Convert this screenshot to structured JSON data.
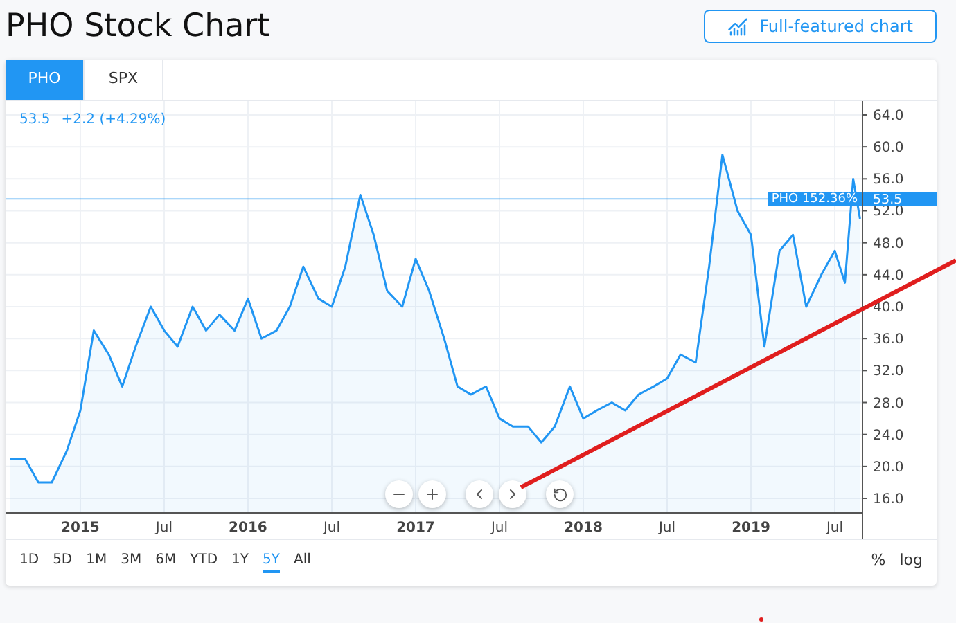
{
  "page_title": "PHO Stock Chart",
  "full_chart_button": "Full-featured chart",
  "tabs": [
    {
      "label": "PHO",
      "selected": true
    },
    {
      "label": "SPX",
      "selected": false
    }
  ],
  "legend": {
    "price": "53.5",
    "change": "+2.2 (+4.29%)"
  },
  "chart": {
    "chart_data": {
      "type": "area",
      "x": [
        2014.58,
        2014.67,
        2014.75,
        2014.83,
        2014.92,
        2015.0,
        2015.08,
        2015.17,
        2015.25,
        2015.33,
        2015.42,
        2015.5,
        2015.58,
        2015.67,
        2015.75,
        2015.83,
        2015.92,
        2016.0,
        2016.08,
        2016.17,
        2016.25,
        2016.33,
        2016.42,
        2016.5,
        2016.58,
        2016.67,
        2016.75,
        2016.83,
        2016.92,
        2017.0,
        2017.08,
        2017.17,
        2017.25,
        2017.33,
        2017.42,
        2017.5,
        2017.58,
        2017.67,
        2017.75,
        2017.83,
        2017.92,
        2018.0,
        2018.08,
        2018.17,
        2018.25,
        2018.33,
        2018.42,
        2018.5,
        2018.58,
        2018.67,
        2018.75,
        2018.83,
        2018.92,
        2019.0,
        2019.08,
        2019.17,
        2019.25,
        2019.33,
        2019.42,
        2019.5,
        2019.56,
        2019.61,
        2019.65
      ],
      "series": [
        {
          "name": "PHO",
          "color": "#2196f3",
          "values": [
            21,
            21,
            18,
            18,
            22,
            27,
            37,
            34,
            30,
            35,
            40,
            37,
            35,
            40,
            37,
            39,
            37,
            41,
            36,
            37,
            40,
            45,
            41,
            40,
            45,
            54,
            49,
            42,
            40,
            46,
            42,
            36,
            30,
            29,
            30,
            26,
            25,
            25,
            23,
            25,
            30,
            26,
            27,
            28,
            27,
            29,
            30,
            31,
            34,
            33,
            45,
            59,
            52,
            49,
            35,
            47,
            49,
            40,
            44,
            47,
            43,
            56,
            51
          ]
        }
      ],
      "xlim": [
        2014.554,
        2019.661
      ],
      "ylim": [
        14.27,
        65.73
      ],
      "xticks": [
        {
          "value": 2015,
          "label": "2015"
        },
        {
          "value": 2015.5,
          "label": "Jul"
        },
        {
          "value": 2016,
          "label": "2016"
        },
        {
          "value": 2016.5,
          "label": "Jul"
        },
        {
          "value": 2017,
          "label": "2017"
        },
        {
          "value": 2017.5,
          "label": "Jul"
        },
        {
          "value": 2018,
          "label": "2018"
        },
        {
          "value": 2018.5,
          "label": "Jul"
        },
        {
          "value": 2019,
          "label": "2019"
        },
        {
          "value": 2019.5,
          "label": "Jul"
        }
      ],
      "yticks": [
        {
          "value": 16,
          "label": "16.0"
        },
        {
          "value": 20,
          "label": "20.0"
        },
        {
          "value": 24,
          "label": "24.0"
        },
        {
          "value": 28,
          "label": "28.0"
        },
        {
          "value": 32,
          "label": "32.0"
        },
        {
          "value": 36,
          "label": "36.0"
        },
        {
          "value": 40,
          "label": "40.0"
        },
        {
          "value": 44,
          "label": "44.0"
        },
        {
          "value": 48,
          "label": "48.0"
        },
        {
          "value": 52,
          "label": "52.0"
        },
        {
          "value": 56,
          "label": "56.0"
        },
        {
          "value": 60,
          "label": "60.0"
        },
        {
          "value": 64,
          "label": "64.0"
        }
      ],
      "grid": true,
      "ref_lines": [
        {
          "axis": "y",
          "value": 53.5
        }
      ]
    },
    "series_badge": {
      "percent": "152.36%",
      "price": "53.5"
    }
  },
  "ranges": [
    {
      "label": "1D",
      "selected": false
    },
    {
      "label": "5D",
      "selected": false
    },
    {
      "label": "1M",
      "selected": false
    },
    {
      "label": "3M",
      "selected": false
    },
    {
      "label": "6M",
      "selected": false
    },
    {
      "label": "YTD",
      "selected": false
    },
    {
      "label": "1Y",
      "selected": false
    },
    {
      "label": "5Y",
      "selected": true
    },
    {
      "label": "All",
      "selected": false
    }
  ],
  "scale_options": [
    "%",
    "log"
  ]
}
